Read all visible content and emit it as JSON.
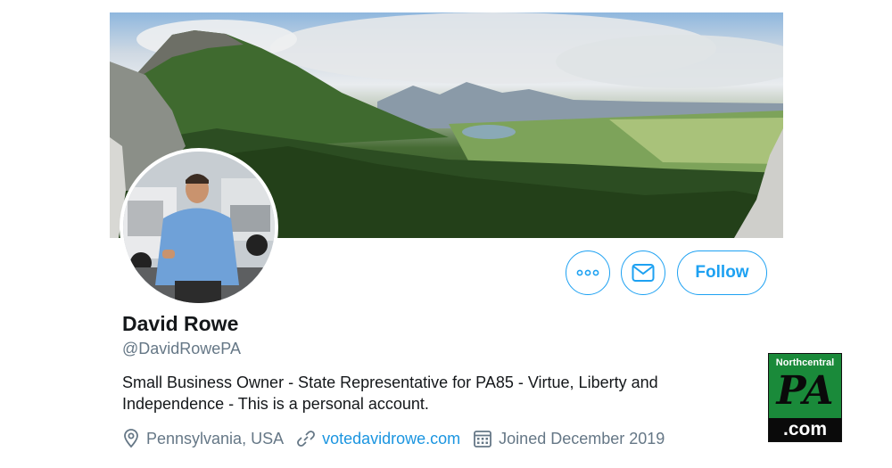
{
  "profile": {
    "display_name": "David Rowe",
    "handle": "@DavidRowePA",
    "bio": "Small Business Owner - State Representative for PA85 - Virtue, Liberty and Independence - This is a personal account.",
    "location": "Pennsylvania, USA",
    "website": "votedavidrowe.com",
    "joined": "Joined December 2019"
  },
  "actions": {
    "follow_label": "Follow"
  },
  "icons": {
    "more": "more-icon",
    "message": "envelope-icon",
    "location": "location-pin-icon",
    "website": "link-icon",
    "joined": "calendar-icon"
  },
  "watermark": {
    "top_text": "Northcentral",
    "big_text": "PA",
    "bottom_text": ".com"
  },
  "colors": {
    "accent": "#1da1f2",
    "link": "#1b95e0",
    "secondary_text": "#657786",
    "logo_green": "#1a8a3a"
  }
}
